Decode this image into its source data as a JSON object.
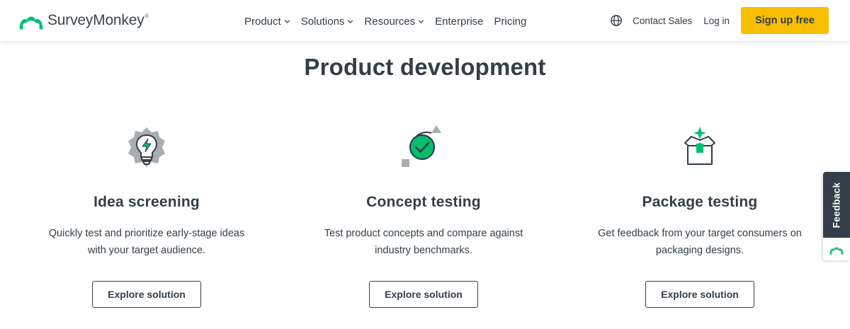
{
  "header": {
    "logo_text": "SurveyMonkey",
    "logo_tm": "®",
    "nav": [
      {
        "label": "Product",
        "has_dropdown": true
      },
      {
        "label": "Solutions",
        "has_dropdown": true
      },
      {
        "label": "Resources",
        "has_dropdown": true
      },
      {
        "label": "Enterprise",
        "has_dropdown": false
      },
      {
        "label": "Pricing",
        "has_dropdown": false
      }
    ],
    "globe_icon": "globe-icon",
    "contact_sales": "Contact Sales",
    "login": "Log in",
    "signup": "Sign up free"
  },
  "main": {
    "title": "Product development",
    "cards": [
      {
        "icon": "lightbulb-bolt-icon",
        "title": "Idea screening",
        "description": "Quickly test and prioritize early-stage ideas with your target audience.",
        "button": "Explore solution"
      },
      {
        "icon": "checkmark-circle-icon",
        "title": "Concept testing",
        "description": "Test product concepts and compare against industry benchmarks.",
        "button": "Explore solution"
      },
      {
        "icon": "open-box-icon",
        "title": "Package testing",
        "description": "Get feedback from your target consumers on packaging designs.",
        "button": "Explore solution"
      }
    ]
  },
  "feedback": {
    "label": "Feedback",
    "icon": "surveymonkey-logo-icon"
  },
  "colors": {
    "brand_green": "#00bf6f",
    "signup_yellow": "#f9be00",
    "text_dark": "#333e48",
    "accent_gray": "#a8adb2"
  }
}
